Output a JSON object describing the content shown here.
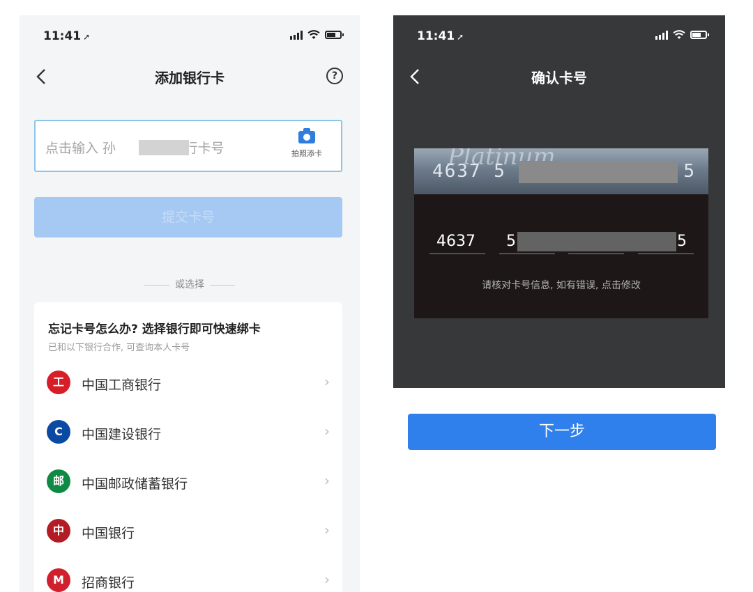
{
  "left": {
    "status": {
      "time": "11:41",
      "location_icon": "location-arrow-icon",
      "signal_icon": "signal-icon",
      "wifi_icon": "wifi-icon",
      "battery_icon": "battery-icon"
    },
    "nav": {
      "back_icon": "back-chevron-icon",
      "title": "添加银行卡",
      "help_icon": "help-circle-icon",
      "help_glyph": "?"
    },
    "card_input": {
      "placeholder_prefix": "点击输入 孙",
      "placeholder_suffix": ")银行卡号",
      "scan_icon": "camera-icon",
      "scan_label": "拍照添卡"
    },
    "submit_label": "提交卡号",
    "divider_text": "或选择",
    "panel": {
      "title": "忘记卡号怎么办? 选择银行即可快速绑卡",
      "subtitle": "已和以下银行合作, 可查询本人卡号",
      "banks": [
        {
          "name": "中国工商银行",
          "logo_icon": "icbc-logo-icon",
          "logo_glyph": "工",
          "color": "#d71e28"
        },
        {
          "name": "中国建设银行",
          "logo_icon": "ccb-logo-icon",
          "logo_glyph": "C",
          "color": "#0b4aa2"
        },
        {
          "name": "中国邮政储蓄银行",
          "logo_icon": "psbc-logo-icon",
          "logo_glyph": "邮",
          "color": "#0f8a44"
        },
        {
          "name": "中国银行",
          "logo_icon": "boc-logo-icon",
          "logo_glyph": "中",
          "color": "#b21c24"
        },
        {
          "name": "招商银行",
          "logo_icon": "cmb-logo-icon",
          "logo_glyph": "M",
          "color": "#d0202e"
        }
      ]
    }
  },
  "right": {
    "status": {
      "time": "11:41"
    },
    "nav": {
      "back_icon": "back-chevron-icon",
      "title": "确认卡号"
    },
    "card_photo": {
      "brand": "Platinum",
      "number_start": "4637 5",
      "number_end": "5"
    },
    "fields": {
      "seg1": "4637",
      "seg2": "5",
      "seg4": "5"
    },
    "hint": "请核对卡号信息, 如有错误, 点击修改",
    "next_label": "下一步"
  }
}
